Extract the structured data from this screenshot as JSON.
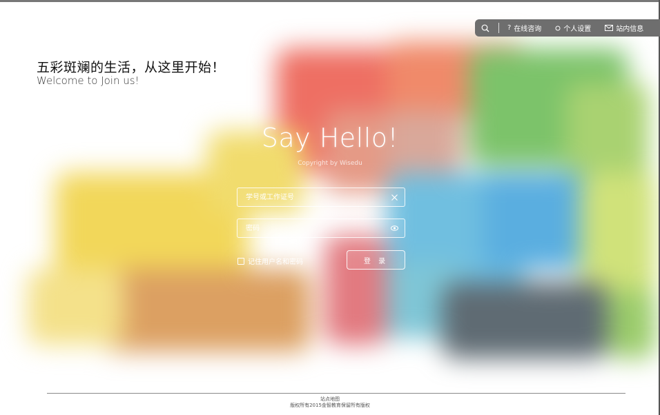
{
  "topbar": {
    "search_icon": "search-icon",
    "items": [
      {
        "icon": "question-icon",
        "label": "在线咨询"
      },
      {
        "icon": "circle-icon",
        "label": "个人设置"
      },
      {
        "icon": "mail-icon",
        "label": "站内信息"
      }
    ]
  },
  "hero": {
    "title": "五彩斑斓的生活，从这里开始！",
    "subtitle": "Welcome to Join us!"
  },
  "login": {
    "heading": "Say Hello!",
    "copyright": "Copyright by Wisedu",
    "username_placeholder": "学号或工作证号",
    "password_placeholder": "密码",
    "remember_label": "记住用户名和密码",
    "submit_label": "登 录"
  },
  "footer": {
    "sitemap": "站点地图",
    "rights": "版权所有2015金智教育保留所有版权"
  },
  "colors": {
    "topbar_bg": "#6e6e6e",
    "text_light": "#ffffff"
  }
}
